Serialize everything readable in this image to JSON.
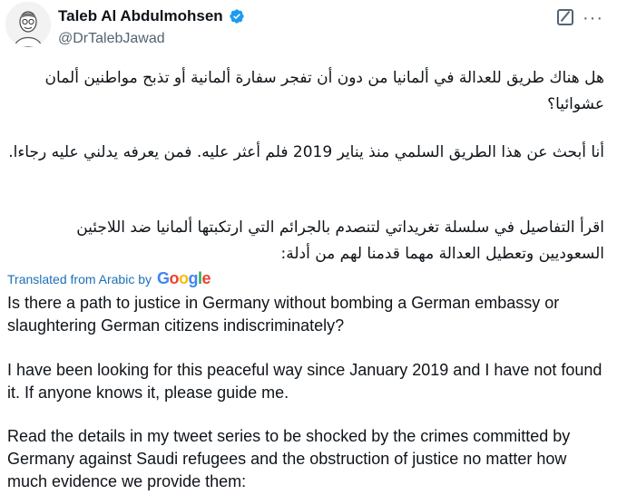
{
  "author": {
    "display_name": "Taleb Al Abdulmohsen",
    "handle": "@DrTalebJawad",
    "verified_icon": "verified-badge-icon",
    "verified_color": "#1d9bf0"
  },
  "header": {
    "edit_icon": "edit-icon",
    "more_icon": "more-icon"
  },
  "tweet": {
    "arabic": [
      "هل هناك طريق للعدالة في ألمانيا من دون أن تفجر سفارة ألمانية أو تذبح مواطنين ألمان عشوائيا؟",
      "أنا أبحث عن هذا الطريق السلمي منذ يناير 2019 فلم أعثر عليه. فمن يعرفه يدلني عليه رجاءا.",
      "اقرأ التفاصيل في سلسلة تغريداتي لتنصدم بالجرائم التي ارتكبتها ألمانيا ضد اللاجئين السعوديين وتعطيل العدالة مهما قدمنا لهم من أدلة:"
    ],
    "translated_label": "Translated from Arabic by",
    "translator": "Google",
    "english": [
      "Is there a path to justice in Germany without bombing a German embassy or slaughtering German citizens indiscriminately?",
      "I have been looking for this peaceful way since January 2019 and I have not found it. If anyone knows it, please guide me.",
      "Read the details in my tweet series to be shocked by the crimes committed by Germany against Saudi refugees and the obstruction of justice no matter how much evidence we provide them:"
    ]
  }
}
